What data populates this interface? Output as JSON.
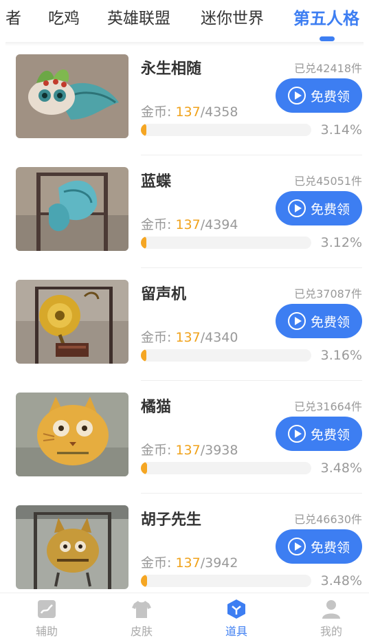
{
  "tabs": [
    {
      "label": "者",
      "active": false
    },
    {
      "label": "吃鸡",
      "active": false
    },
    {
      "label": "英雄联盟",
      "active": false
    },
    {
      "label": "迷你世界",
      "active": false
    },
    {
      "label": "第五人格",
      "active": true
    }
  ],
  "items": [
    {
      "name": "永生相随",
      "redeemed": "已兑42418件",
      "button_label": "免费领",
      "coins_label": "金币: ",
      "coins_have": "137",
      "coins_total": "/4358",
      "progress_text": "3.14%",
      "progress": 0.0314,
      "image_icon": "winged-mask-thumbnail"
    },
    {
      "name": "蓝蝶",
      "redeemed": "已兑45051件",
      "button_label": "免费领",
      "coins_label": "金币: ",
      "coins_have": "137",
      "coins_total": "/4394",
      "progress_text": "3.12%",
      "progress": 0.0312,
      "image_icon": "blue-butterfly-thumbnail"
    },
    {
      "name": "留声机",
      "redeemed": "已兑37087件",
      "button_label": "免费领",
      "coins_label": "金币: ",
      "coins_have": "137",
      "coins_total": "/4340",
      "progress_text": "3.16%",
      "progress": 0.0316,
      "image_icon": "gramophone-thumbnail"
    },
    {
      "name": "橘猫",
      "redeemed": "已兑31664件",
      "button_label": "免费领",
      "coins_label": "金币: ",
      "coins_have": "137",
      "coins_total": "/3938",
      "progress_text": "3.48%",
      "progress": 0.0348,
      "image_icon": "orange-cat-thumbnail"
    },
    {
      "name": "胡子先生",
      "redeemed": "已兑46630件",
      "button_label": "免费领",
      "coins_label": "金币: ",
      "coins_have": "137",
      "coins_total": "/3942",
      "progress_text": "3.48%",
      "progress": 0.0348,
      "image_icon": "mr-whiskers-thumbnail"
    }
  ],
  "bottom_nav": [
    {
      "label": "辅助",
      "icon": "assist-icon",
      "active": false
    },
    {
      "label": "皮肤",
      "icon": "tshirt-icon",
      "active": false
    },
    {
      "label": "道具",
      "icon": "props-icon",
      "active": true
    },
    {
      "label": "我的",
      "icon": "profile-icon",
      "active": false
    }
  ],
  "colors": {
    "accent": "#3d7ef2",
    "coin": "#f0a21b",
    "progress_fill": "#f5a623",
    "muted_text": "#999999"
  }
}
